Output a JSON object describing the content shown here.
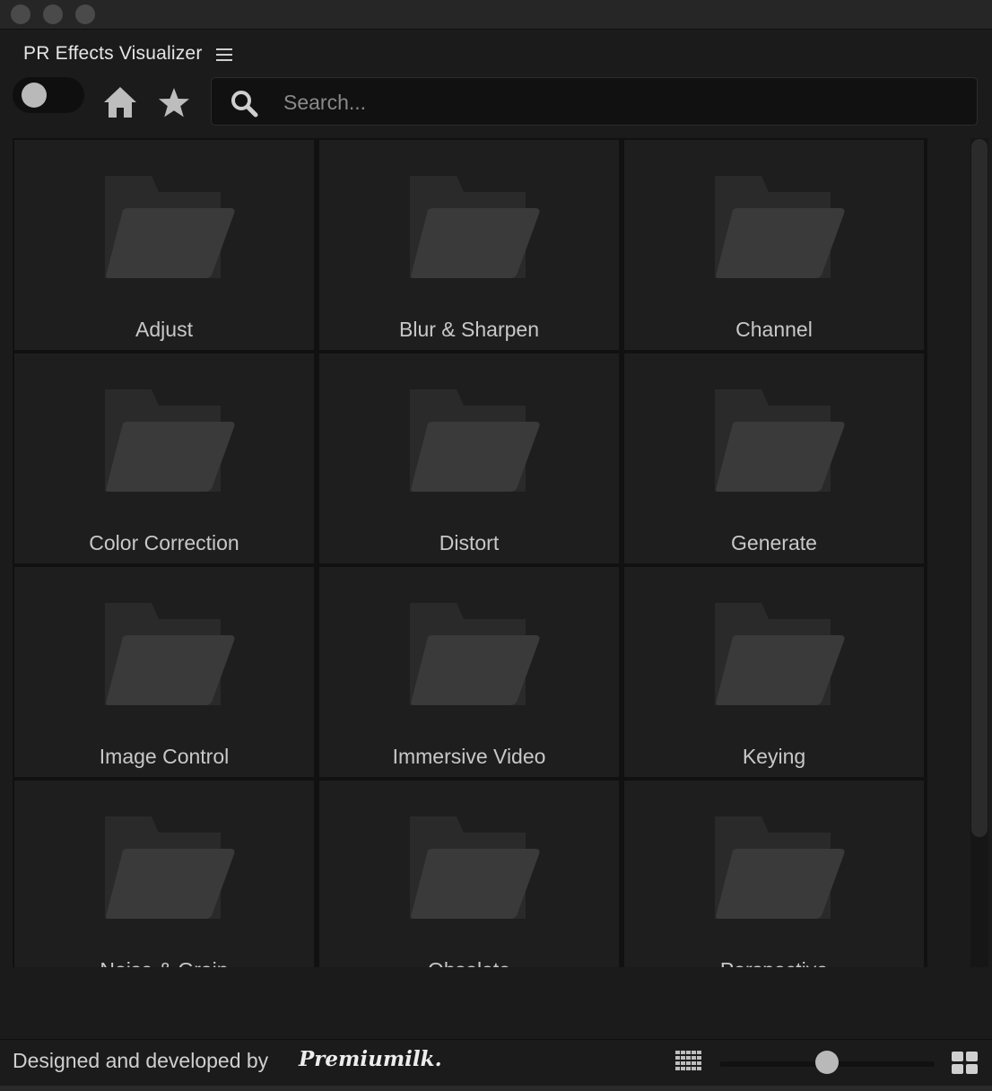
{
  "panel": {
    "title": "PR Effects Visualizer"
  },
  "search": {
    "placeholder": "Search..."
  },
  "icons": {
    "menu": "hamburger-menu-icon",
    "home": "home-icon",
    "favorites": "star-icon",
    "search": "search-icon",
    "folder": "folder-icon",
    "small_grid": "small-grid-view-icon",
    "large_grid": "large-grid-view-icon"
  },
  "categories": [
    {
      "label": "Adjust"
    },
    {
      "label": "Blur & Sharpen"
    },
    {
      "label": "Channel"
    },
    {
      "label": "Color Correction"
    },
    {
      "label": "Distort"
    },
    {
      "label": "Generate"
    },
    {
      "label": "Image Control"
    },
    {
      "label": "Immersive Video"
    },
    {
      "label": "Keying"
    },
    {
      "label": "Noise & Grain"
    },
    {
      "label": "Obsolete"
    },
    {
      "label": "Perspective"
    }
  ],
  "footer": {
    "credit": "Designed and developed by",
    "brand": "Premiumilk.",
    "zoom_level": 0.5
  },
  "colors": {
    "background": "#1b1b1b",
    "tile": "#1e1e1e",
    "folder": "#3a3a3a",
    "folder_back": "#2a2a2a",
    "text": "#c8c8c8"
  }
}
